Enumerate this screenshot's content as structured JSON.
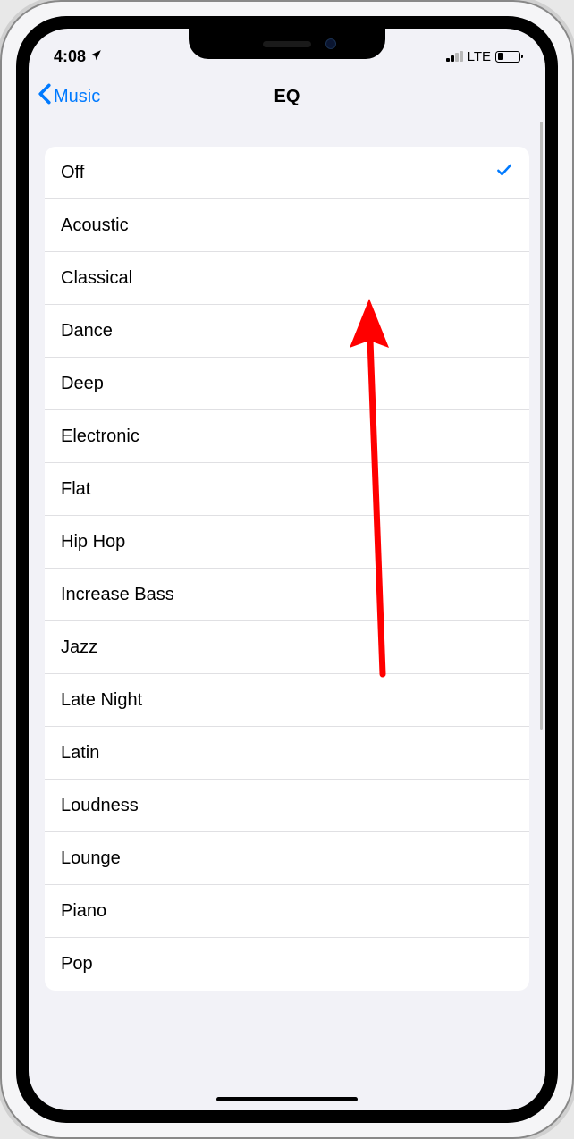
{
  "statusBar": {
    "time": "4:08",
    "networkLabel": "LTE"
  },
  "navBar": {
    "backLabel": "Music",
    "title": "EQ"
  },
  "eqOptions": [
    {
      "label": "Off",
      "selected": true
    },
    {
      "label": "Acoustic",
      "selected": false
    },
    {
      "label": "Classical",
      "selected": false
    },
    {
      "label": "Dance",
      "selected": false
    },
    {
      "label": "Deep",
      "selected": false
    },
    {
      "label": "Electronic",
      "selected": false
    },
    {
      "label": "Flat",
      "selected": false
    },
    {
      "label": "Hip Hop",
      "selected": false
    },
    {
      "label": "Increase Bass",
      "selected": false
    },
    {
      "label": "Jazz",
      "selected": false
    },
    {
      "label": "Late Night",
      "selected": false
    },
    {
      "label": "Latin",
      "selected": false
    },
    {
      "label": "Loudness",
      "selected": false
    },
    {
      "label": "Lounge",
      "selected": false
    },
    {
      "label": "Piano",
      "selected": false
    },
    {
      "label": "Pop",
      "selected": false
    }
  ]
}
